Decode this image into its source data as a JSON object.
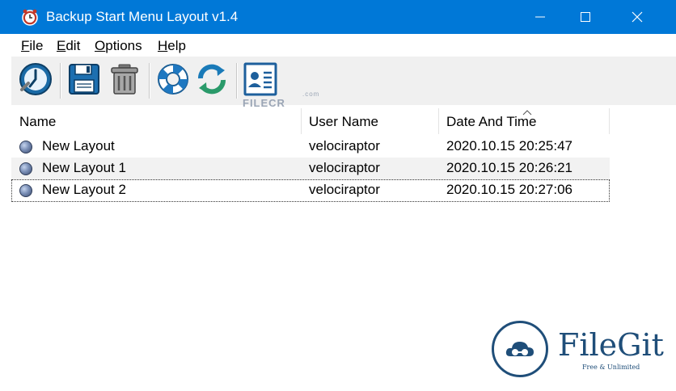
{
  "window": {
    "title": "Backup Start Menu Layout v1.4",
    "accent_color": "#0078d7",
    "controls": {
      "minimize_icon": "minimize-icon",
      "maximize_icon": "maximize-icon",
      "close_icon": "close-icon"
    }
  },
  "menu": {
    "items": [
      {
        "label": "File"
      },
      {
        "label": "Edit"
      },
      {
        "label": "Options"
      },
      {
        "label": "Help"
      }
    ]
  },
  "toolbar": {
    "buttons": [
      {
        "icon": "backup-clock-icon"
      },
      {
        "icon": "save-icon"
      },
      {
        "icon": "delete-trash-icon"
      },
      {
        "icon": "lifebuoy-help-icon"
      },
      {
        "icon": "refresh-icon"
      },
      {
        "icon": "contact-card-icon"
      }
    ]
  },
  "list": {
    "columns": [
      {
        "label": "Name"
      },
      {
        "label": "User Name"
      },
      {
        "label": "Date And Time",
        "sorted": "ascending"
      }
    ],
    "rows": [
      {
        "name": "New Layout",
        "user": "velociraptor",
        "datetime": "2020.10.15 20:25:47"
      },
      {
        "name": "New Layout 1",
        "user": "velociraptor",
        "datetime": "2020.10.15 20:26:21"
      },
      {
        "name": "New Layout 2",
        "user": "velociraptor",
        "datetime": "2020.10.15 20:27:06"
      }
    ]
  },
  "watermarks": {
    "filecr": "FILECR",
    "filecr_small": ".com",
    "filegit_name": "FileGit",
    "filegit_tagline": "Free & Unlimited"
  }
}
